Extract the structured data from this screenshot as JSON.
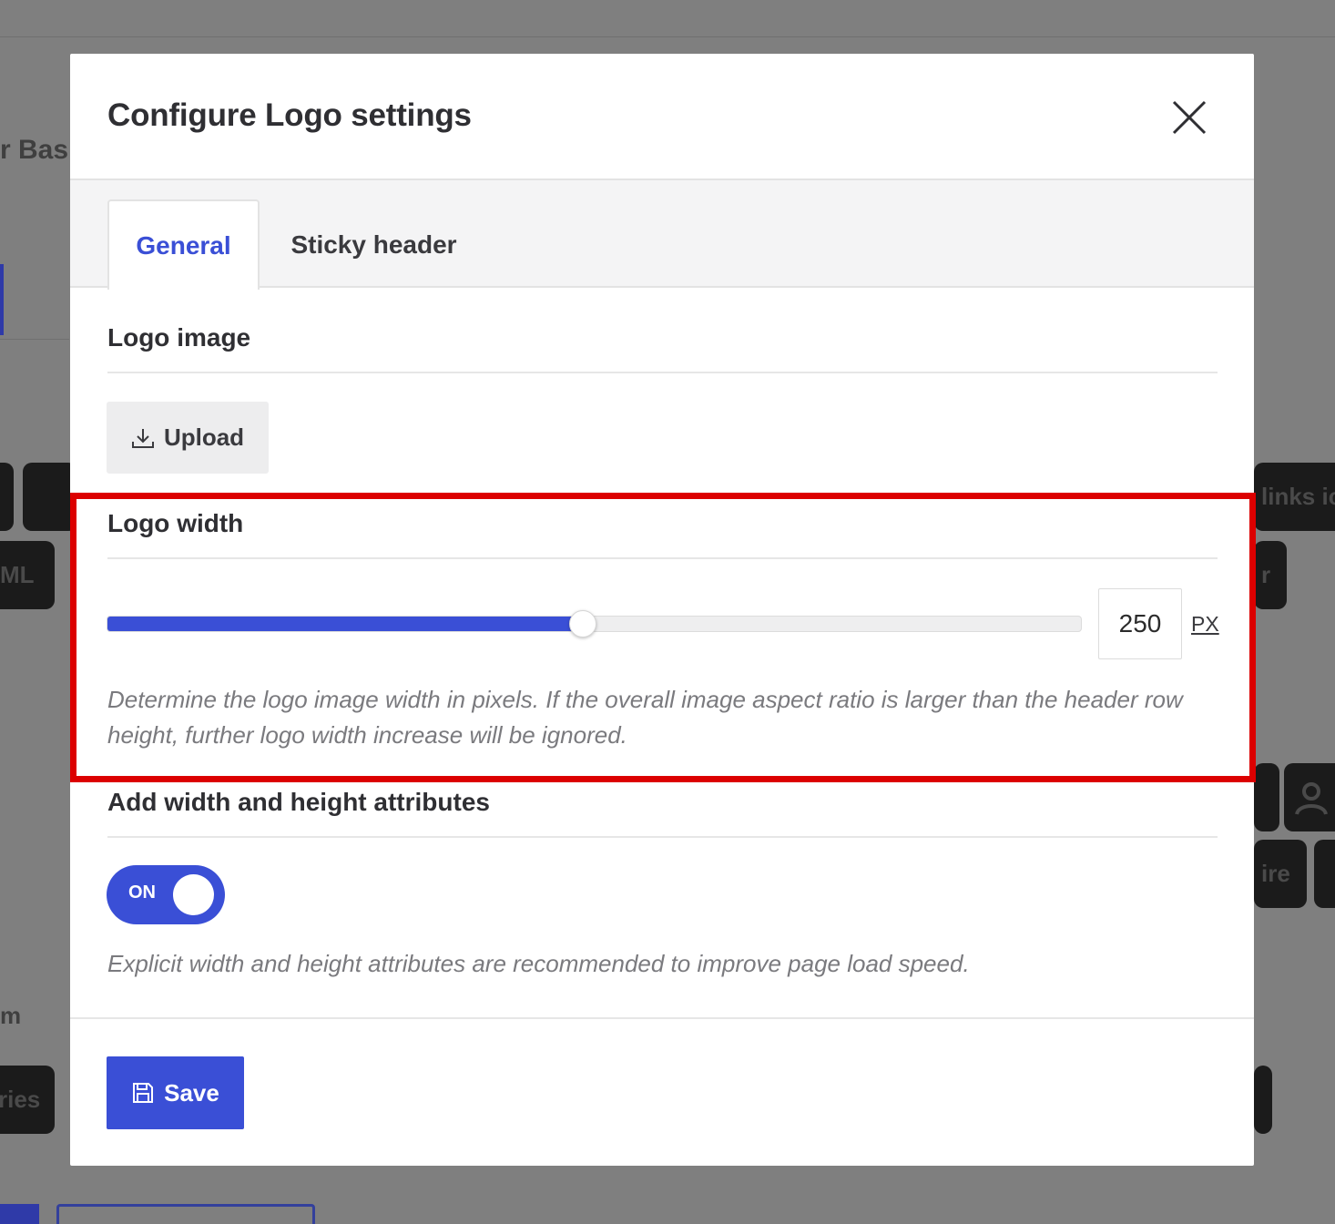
{
  "background": {
    "fragments": [
      "r Base",
      "ML",
      "links ic",
      "r",
      "ire",
      "ries",
      "m"
    ]
  },
  "modal": {
    "title": "Configure Logo settings",
    "close_icon": "close-icon",
    "tabs": [
      {
        "label": "General",
        "active": true
      },
      {
        "label": "Sticky header",
        "active": false
      }
    ],
    "logo_image": {
      "title": "Logo image",
      "upload_label": "Upload",
      "upload_icon": "download-icon"
    },
    "logo_width": {
      "title": "Logo width",
      "slider_fraction": 0.488,
      "value": "250",
      "unit": "PX",
      "help": "Determine the logo image width in pixels. If the overall image aspect ratio is larger than the header row height, further logo width increase will be ignored."
    },
    "attributes": {
      "title": "Add width and height attributes",
      "toggle_label": "ON",
      "toggle_on": true,
      "help": "Explicit width and height attributes are recommended to improve page load speed."
    },
    "save_label": "Save",
    "save_icon": "floppy-disk-icon"
  },
  "colors": {
    "accent": "#3a4fd6",
    "highlight": "#dc0000",
    "overlay": "#7f7f7f"
  }
}
